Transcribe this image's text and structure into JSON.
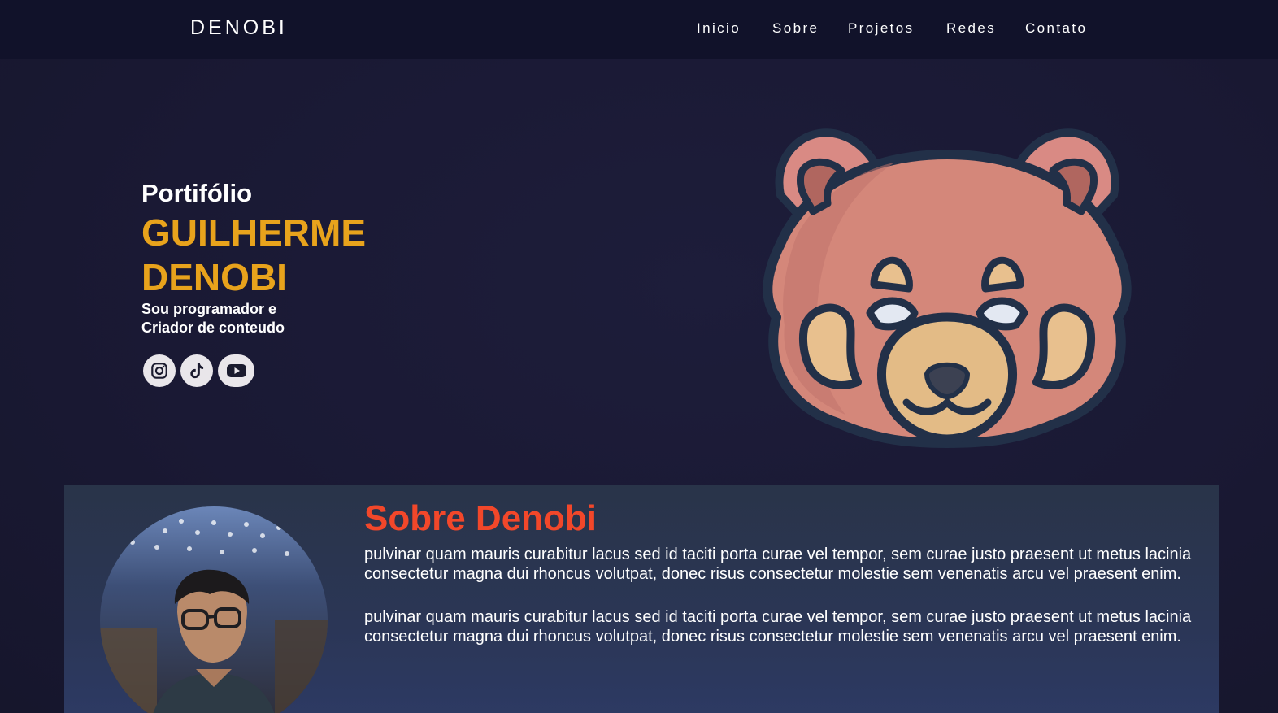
{
  "header": {
    "brand": "DENOBI",
    "nav": [
      "Inicio",
      "Sobre",
      "Projetos",
      "Redes",
      "Contato"
    ]
  },
  "hero": {
    "label": "Portifólio",
    "name_line1": "GUILHERME",
    "name_line2": "DENOBI",
    "tagline": "Sou programador e Criador de conteudo",
    "socials": [
      "instagram-icon",
      "tiktok-icon",
      "youtube-icon"
    ]
  },
  "about": {
    "title": "Sobre Denobi",
    "paragraphs": [
      "pulvinar quam mauris curabitur lacus sed id taciti porta curae vel tempor, sem curae justo praesent ut metus lacinia consectetur magna dui rhoncus volutpat, donec risus consectetur molestie sem venenatis arcu vel praesent enim.",
      "pulvinar quam mauris curabitur lacus sed id taciti porta curae vel tempor, sem curae justo praesent ut metus lacinia consectetur magna dui rhoncus volutpat, donec risus consectetur molestie sem venenatis arcu vel praesent enim."
    ]
  },
  "colors": {
    "accent_name": "#e8a31c",
    "accent_title": "#f2472a",
    "nav_bg": "#11122a",
    "section_bg": "#2b3656"
  }
}
